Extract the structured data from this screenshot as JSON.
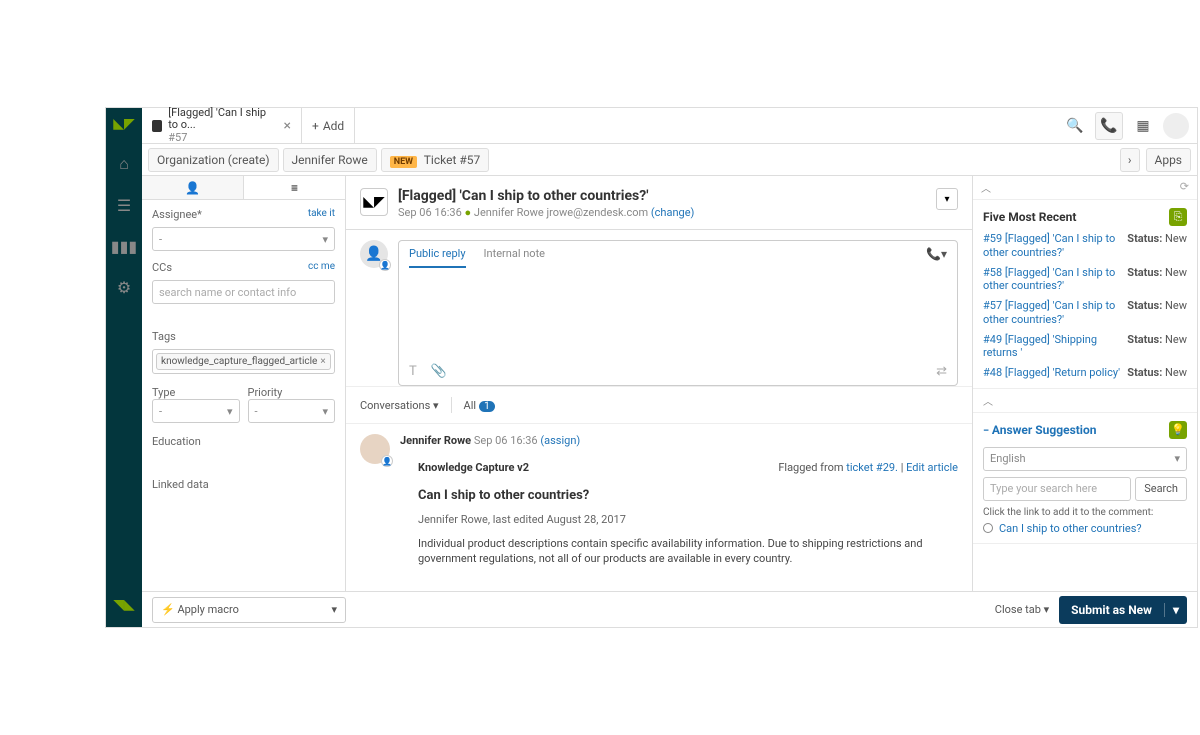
{
  "tab": {
    "title": "[Flagged] 'Can I ship to o...",
    "subtitle": "#57",
    "add": "Add"
  },
  "breadcrumbs": {
    "org": "Organization (create)",
    "user": "Jennifer Rowe",
    "ticket_badge": "NEW",
    "ticket_label": "Ticket #57",
    "apps": "Apps"
  },
  "left": {
    "assignee_label": "Assignee*",
    "take": "take it",
    "assignee_value": "-",
    "ccs_label": "CCs",
    "cc_me": "cc me",
    "cc_placeholder": "search name or contact info",
    "tags_label": "Tags",
    "tag_value": "knowledge_capture_flagged_article",
    "type_label": "Type",
    "type_value": "-",
    "priority_label": "Priority",
    "priority_value": "-",
    "education_label": "Education",
    "linked_label": "Linked data"
  },
  "ticket": {
    "title": "[Flagged] 'Can I ship to other countries?'",
    "date": "Sep 06 16:36",
    "requester": "Jennifer Rowe",
    "email": "jrowe@zendesk.com",
    "change": "(change)"
  },
  "compose": {
    "public": "Public reply",
    "internal": "Internal note"
  },
  "convo": {
    "label": "Conversations",
    "all": "All",
    "count": "1"
  },
  "thread": {
    "author": "Jennifer Rowe",
    "meta": "Sep 06 16:36",
    "assign": "(assign)",
    "kc_head": "Knowledge Capture v2",
    "flagged_from": "Flagged from ",
    "flagged_link": "ticket #29.",
    "edit": "Edit article",
    "kc_title": "Can I ship to other countries?",
    "kc_sub": "Jennifer Rowe, last edited August 28, 2017",
    "kc_body": "Individual product descriptions contain specific availability information. Due to shipping restrictions and government regulations, not all of our products are available in every country."
  },
  "right": {
    "recent_title": "Five Most Recent",
    "status_label": "Status:",
    "status_val": "New",
    "items": [
      {
        "link": "#59 [Flagged] 'Can I ship to other countries?'"
      },
      {
        "link": "#58 [Flagged] 'Can I ship to other countries?'"
      },
      {
        "link": "#57 [Flagged] 'Can I ship to other countries?'"
      },
      {
        "link": "#49 [Flagged] 'Shipping returns '"
      },
      {
        "link": "#48 [Flagged] 'Return policy'"
      }
    ],
    "answer_title": "Answer Suggestion",
    "lang": "English",
    "search_ph": "Type your search here",
    "search_btn": "Search",
    "hint": "Click the link to add it to the comment:",
    "result": "Can I ship to other countries?"
  },
  "bottom": {
    "macro": "Apply macro",
    "close": "Close tab",
    "submit": "Submit as New"
  }
}
